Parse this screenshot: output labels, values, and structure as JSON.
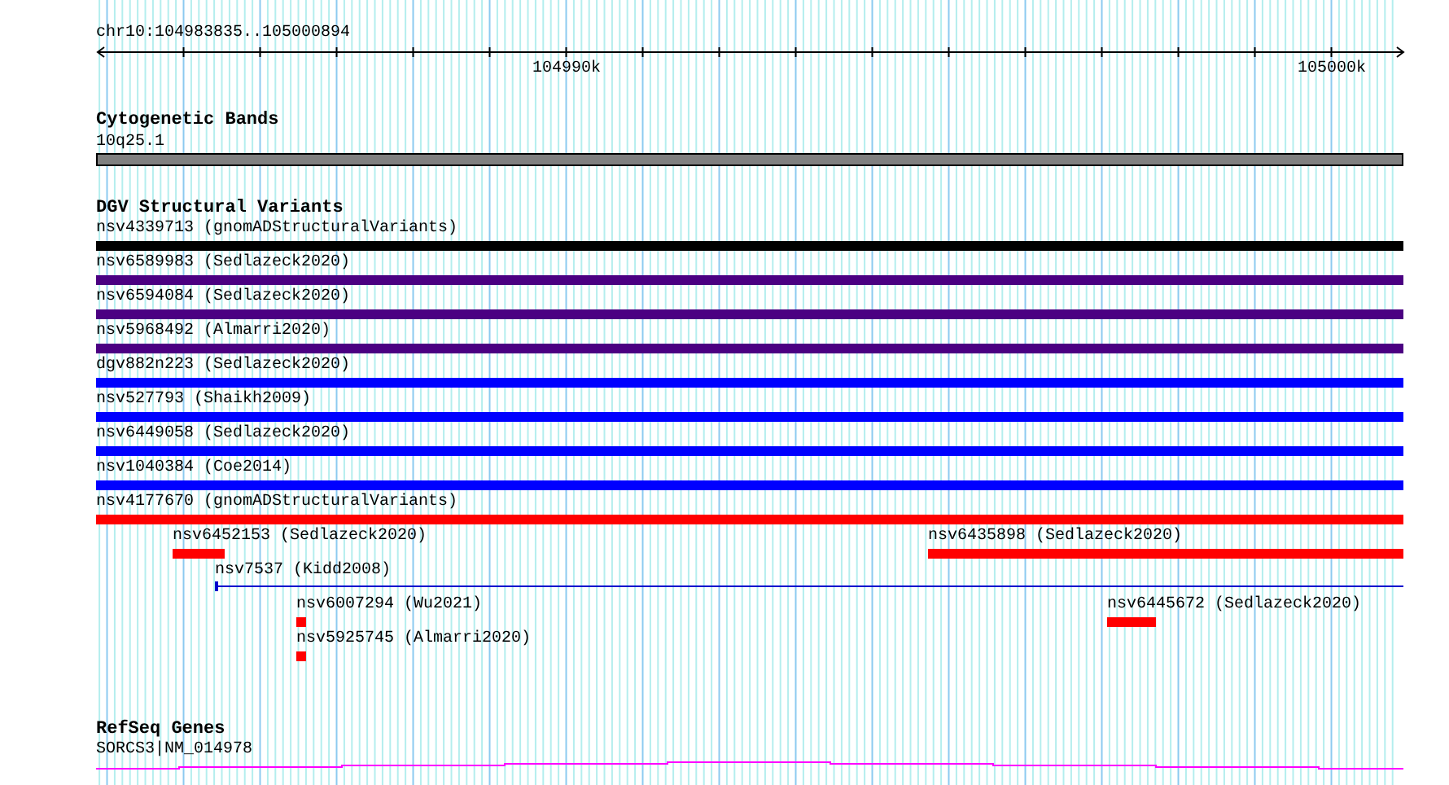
{
  "ruler": {
    "location": "chr10:104983835..105000894",
    "tick_labels": [
      "104990k",
      "105000k"
    ]
  },
  "cytogenetic_bands": {
    "title": "Cytogenetic Bands",
    "band": {
      "label": "10q25.1"
    }
  },
  "dgv_structural_variants": {
    "title": "DGV Structural Variants",
    "features": [
      {
        "label": "nsv4339713 (gnomADStructuralVariants)",
        "color": "#000000",
        "kind": "bar"
      },
      {
        "label": "nsv6589983 (Sedlazeck2020)",
        "color": "#4b0082",
        "kind": "bar"
      },
      {
        "label": "nsv6594084 (Sedlazeck2020)",
        "color": "#4b0082",
        "kind": "bar"
      },
      {
        "label": "nsv5968492 (Almarri2020)",
        "color": "#4b0082",
        "kind": "bar"
      },
      {
        "label": "dgv882n223 (Sedlazeck2020)",
        "color": "#0000ff",
        "kind": "bar"
      },
      {
        "label": "nsv527793 (Shaikh2009)",
        "color": "#0000ff",
        "kind": "bar"
      },
      {
        "label": "nsv6449058 (Sedlazeck2020)",
        "color": "#0000ff",
        "kind": "bar"
      },
      {
        "label": "nsv1040384 (Coe2014)",
        "color": "#0000ff",
        "kind": "bar"
      },
      {
        "label": "nsv4177670 (gnomADStructuralVariants)",
        "color": "#ff0000",
        "kind": "bar"
      },
      {
        "label": "nsv6452153 (Sedlazeck2020)",
        "color": "#ff0000",
        "kind": "bar"
      },
      {
        "label": "nsv6435898 (Sedlazeck2020)",
        "color": "#ff0000",
        "kind": "bar"
      },
      {
        "label": "nsv7537 (Kidd2008)",
        "color": "#0000cd",
        "kind": "line"
      },
      {
        "label": "nsv6007294 (Wu2021)",
        "color": "#ff0000",
        "kind": "bar"
      },
      {
        "label": "nsv6445672 (Sedlazeck2020)",
        "color": "#ff0000",
        "kind": "bar"
      },
      {
        "label": "nsv5925745 (Almarri2020)",
        "color": "#ff0000",
        "kind": "bar"
      }
    ]
  },
  "refseq_genes": {
    "title": "RefSeq Genes",
    "gene": {
      "label": "SORCS3|NM_014978"
    }
  }
}
